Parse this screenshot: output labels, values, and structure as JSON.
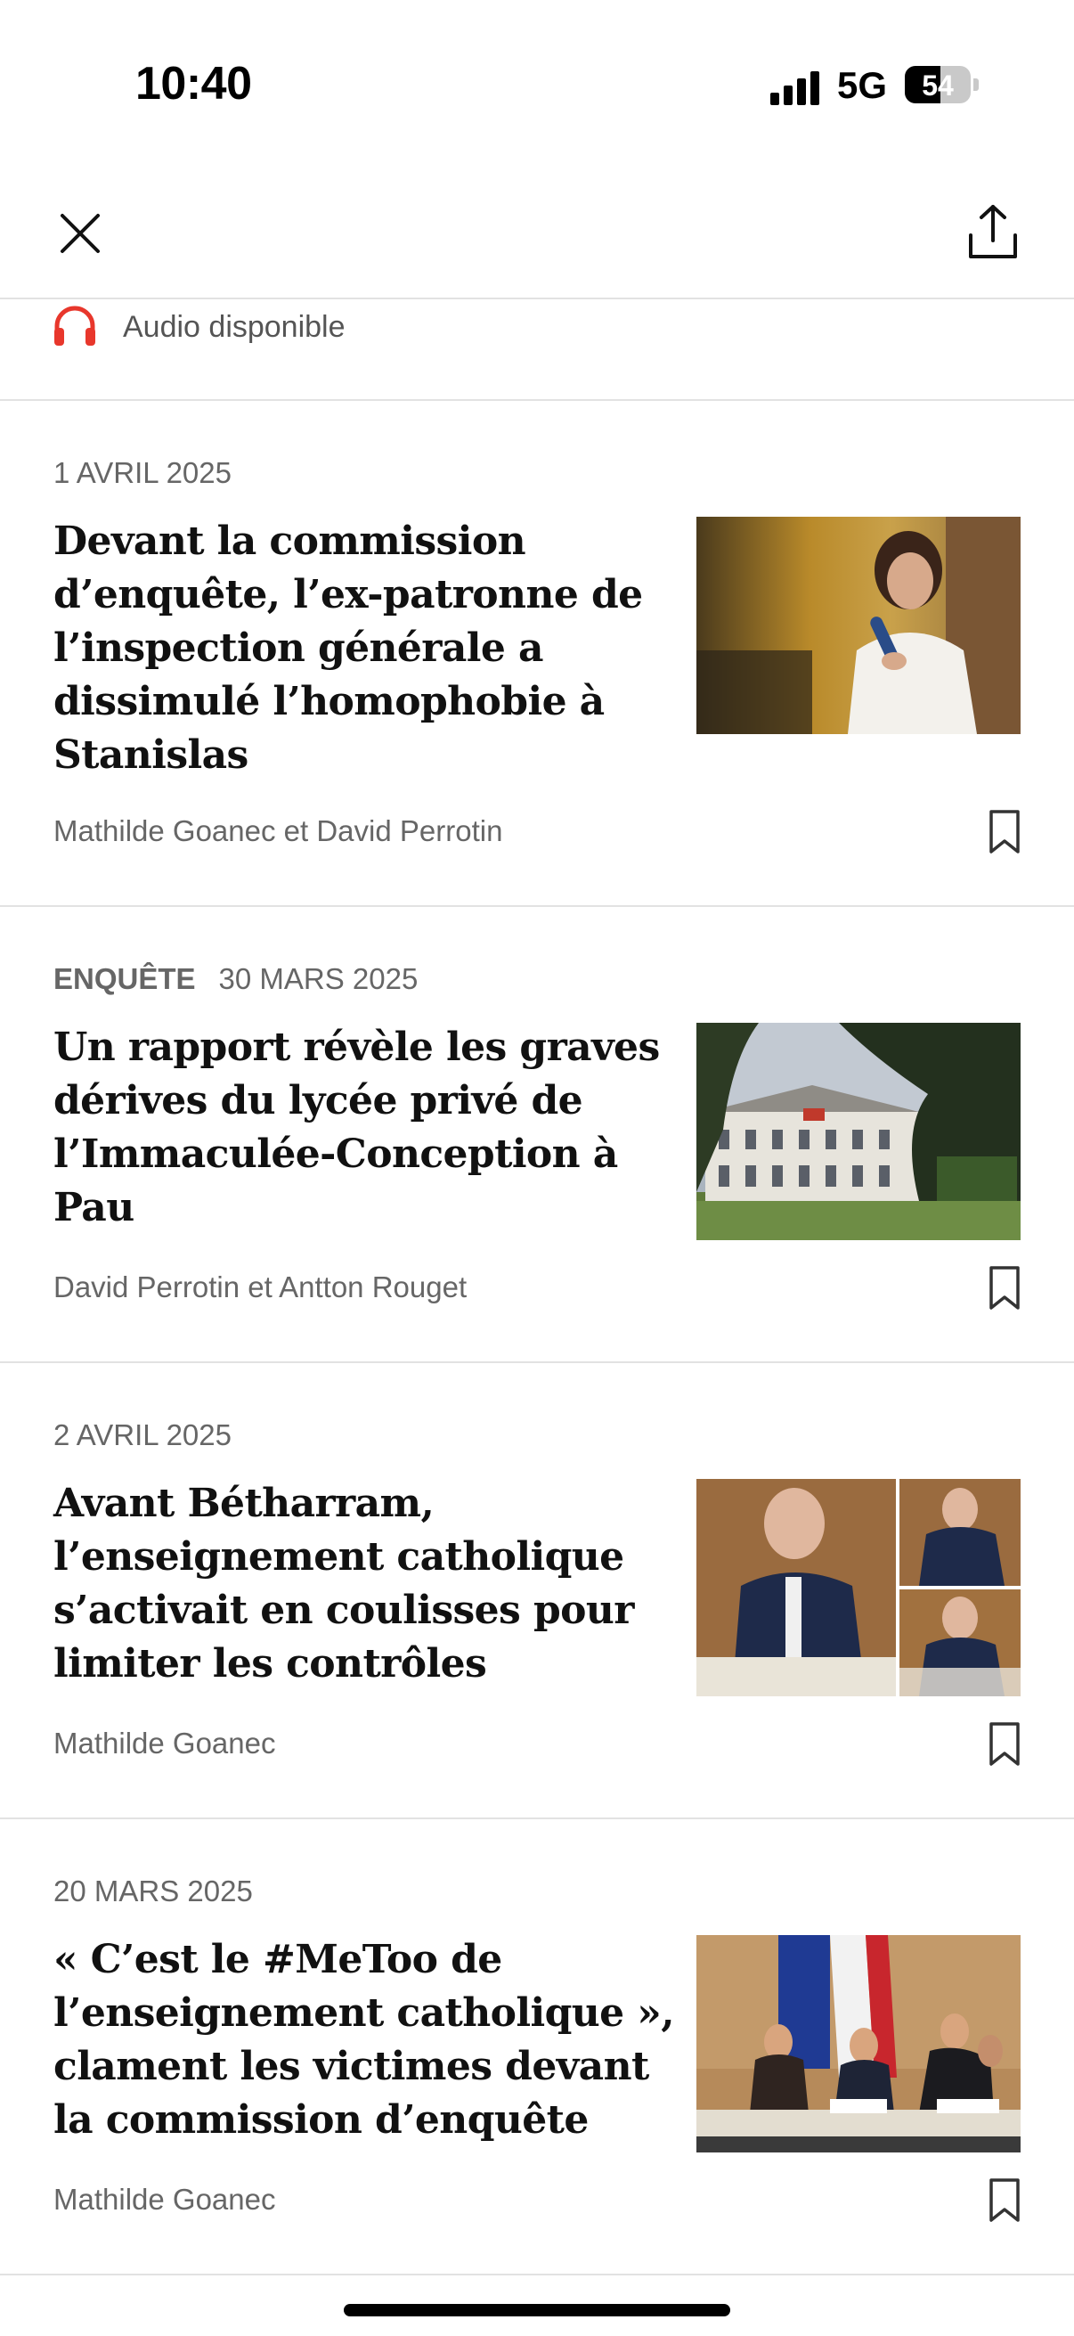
{
  "status_bar": {
    "time": "10:40",
    "network": "5G",
    "battery": "54",
    "battery_level": 0.54
  },
  "nav": {
    "close_icon": "close-icon",
    "share_icon": "share-icon"
  },
  "audio": {
    "label": "Audio disponible",
    "icon": "headphones-icon",
    "accent": "#e8372c"
  },
  "articles": [
    {
      "kicker": "",
      "date": "1 AVRIL 2025",
      "title": "Devant la commission d’enquête, l’ex-patronne de l’inspection générale a dissimulé l’homophobie à Stanislas",
      "byline": "Mathilde Goanec et David Perrotin"
    },
    {
      "kicker": "ENQUÊTE",
      "date": "30 MARS 2025",
      "title": "Un rapport révèle les graves dérives du lycée privé de l’Immaculée-Conception à Pau",
      "byline": "David Perrotin et Antton Rouget"
    },
    {
      "kicker": "",
      "date": "2 AVRIL 2025",
      "title": "Avant Bétharram, l’enseignement catholique s’activait en coulisses pour limiter les contrôles",
      "byline": "Mathilde Goanec"
    },
    {
      "kicker": "",
      "date": "20 MARS 2025",
      "title": "« C’est le #MeToo de l’enseignement catholique », clament les victimes devant la commission d’enquête",
      "byline": "Mathilde Goanec"
    }
  ]
}
